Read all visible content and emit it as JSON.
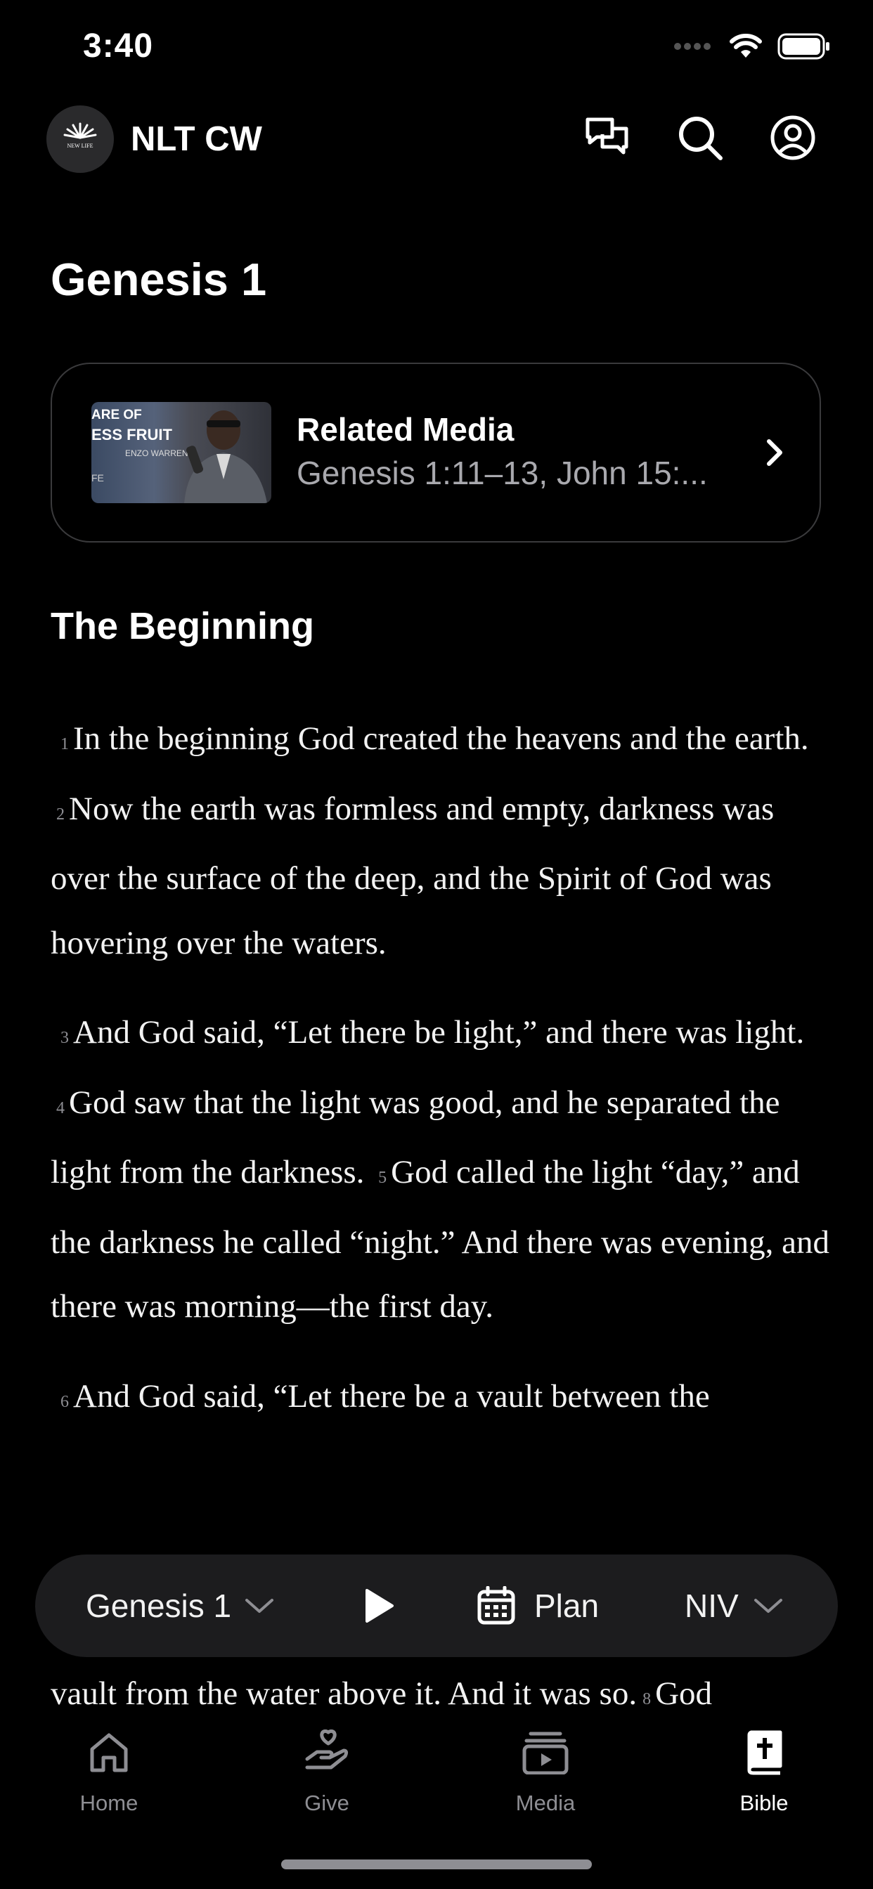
{
  "status_bar": {
    "time": "3:40"
  },
  "header": {
    "logo_text": "NEW LIFE",
    "app_title": "NLT CW",
    "icons": [
      "chat-icon",
      "search-icon",
      "profile-icon"
    ]
  },
  "page_title": "Genesis 1",
  "related_media": {
    "title": "Related Media",
    "subtitle": "Genesis 1:11–13, John 15:...",
    "thumbnail_text": [
      "ARE OF",
      "ESS FRUIT",
      "ENZO WARREN",
      "FE"
    ]
  },
  "section_heading": "The Beginning",
  "verses": [
    {
      "num": "1",
      "text": "In the beginning God created the heavens and the earth."
    },
    {
      "num": "2",
      "text": "Now the earth was formless and empty, darkness was over the surface of the deep, and the Spirit of God was hovering over the waters."
    },
    {
      "num": "3",
      "text": "And God said, “Let there be light,” and there was light."
    },
    {
      "num": "4",
      "text": "God saw that the light was good, and he separated the light from the darkness."
    },
    {
      "num": "5",
      "text": "God called the light “day,” and the darkness he called “night.” And there was evening, and there was morning—the first day."
    },
    {
      "num": "6",
      "text": "And God said, “Let there be a vault between the"
    },
    {
      "num": "8",
      "text": "God"
    }
  ],
  "lower_text": "vault from the water above it. And it was so.",
  "control_bar": {
    "chapter": "Genesis 1",
    "plan_label": "Plan",
    "version": "NIV"
  },
  "tabs": [
    {
      "label": "Home",
      "icon": "home-icon",
      "active": false
    },
    {
      "label": "Give",
      "icon": "give-icon",
      "active": false
    },
    {
      "label": "Media",
      "icon": "media-icon",
      "active": false
    },
    {
      "label": "Bible",
      "icon": "bible-icon",
      "active": true
    }
  ],
  "colors": {
    "background": "#000000",
    "secondary_text": "#8e8e93",
    "control_bar": "#1c1c1e"
  }
}
